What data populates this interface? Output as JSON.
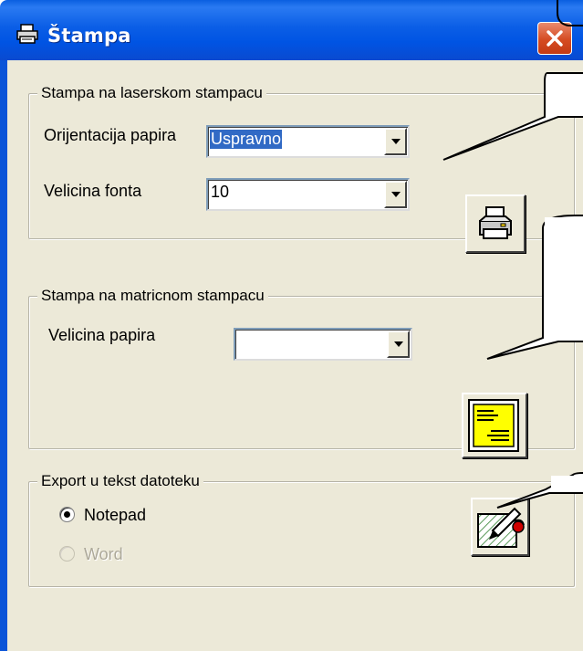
{
  "window": {
    "title": "Štampa",
    "title_icon": "printer-icon",
    "close_icon": "close-icon"
  },
  "laser": {
    "group_label": "Stampa na laserskom stampacu",
    "orientation_label": "Orijentacija papira",
    "orientation_value": "Uspravno",
    "font_size_label": "Velicina fonta",
    "font_size_value": "10",
    "print_button_icon": "printer-icon"
  },
  "matrix": {
    "group_label": "Stampa na matricnom stampacu",
    "paper_size_label": "Velicina papira",
    "paper_size_value": "",
    "print_button_icon": "document-preview-icon"
  },
  "export": {
    "group_label": "Export u tekst datoteku",
    "options": [
      {
        "label": "Notepad",
        "selected": true,
        "enabled": true
      },
      {
        "label": "Word",
        "selected": false,
        "enabled": false
      }
    ],
    "export_button_icon": "pen-document-icon"
  },
  "colors": {
    "titlebar": "#0054e3",
    "client_bg": "#ece9d8",
    "selection": "#316ac5",
    "close_button": "#d54b22",
    "callout_bg": "#ffffff",
    "doc_icon_fill": "#ffff00"
  }
}
